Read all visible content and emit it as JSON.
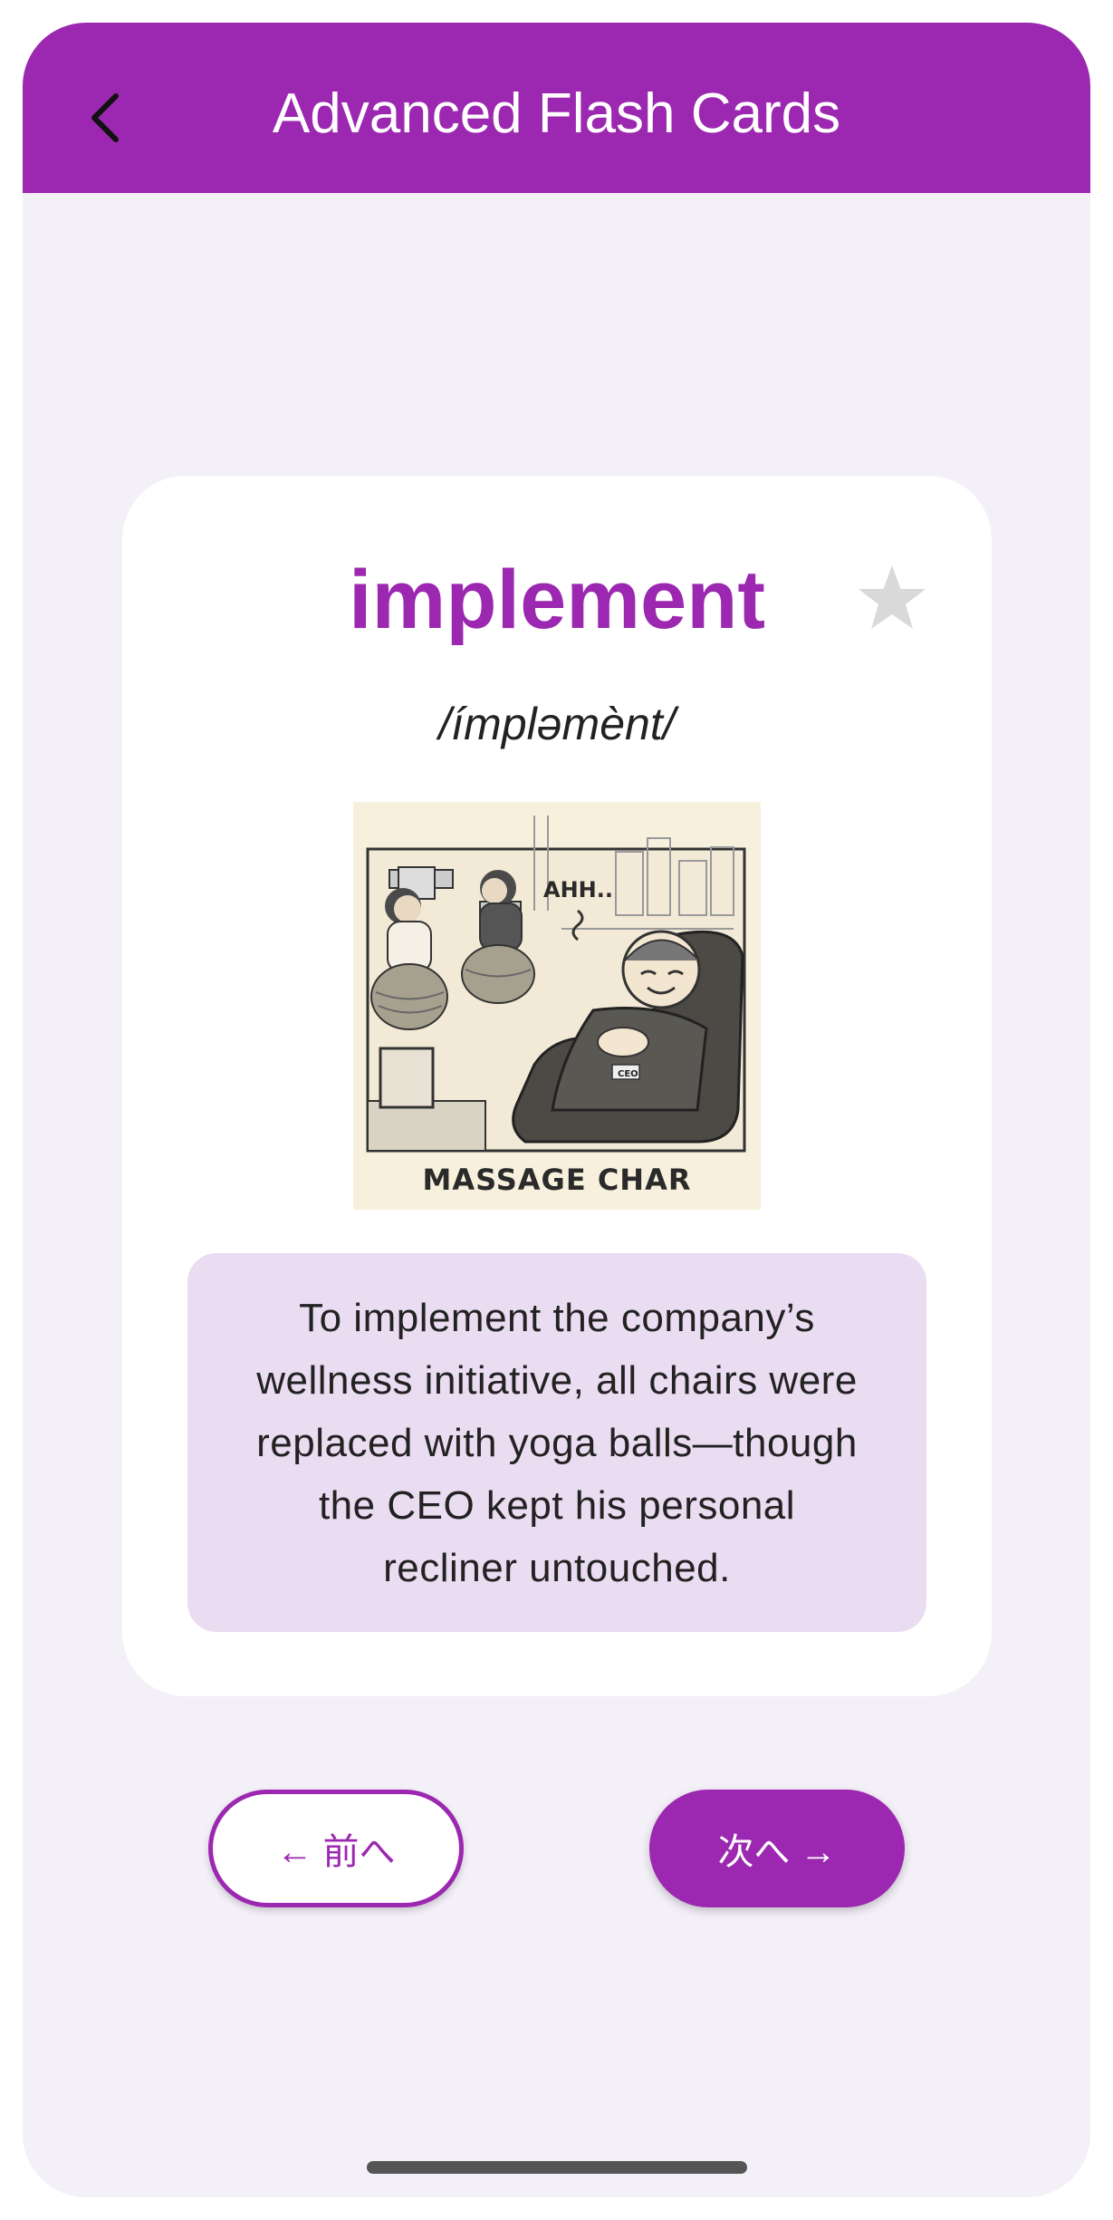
{
  "appbar": {
    "title": "Advanced Flash Cards",
    "back_icon": "chevron-left-icon",
    "color": "#9c27b0"
  },
  "card": {
    "word": "implement",
    "pronunciation": "/ímpləmènt/",
    "favorite_icon": "star-icon",
    "favorite_active": false,
    "illustration": {
      "caption": "MASSAGE CHAR",
      "speech": "AHH..",
      "badge": "CEO"
    },
    "example_sentence_lines": [
      "To implement the company’s",
      "wellness initiative, all chairs were",
      "replaced with yoga balls—though",
      "the CEO kept his personal",
      "recliner untouched."
    ]
  },
  "nav": {
    "prev_label": "← 前へ",
    "next_label": "次へ →"
  },
  "colors": {
    "accent": "#9c27b0",
    "background": "#f4f0f8",
    "sentence_bg": "#eadcf1",
    "star_inactive": "#d9d9d9"
  }
}
